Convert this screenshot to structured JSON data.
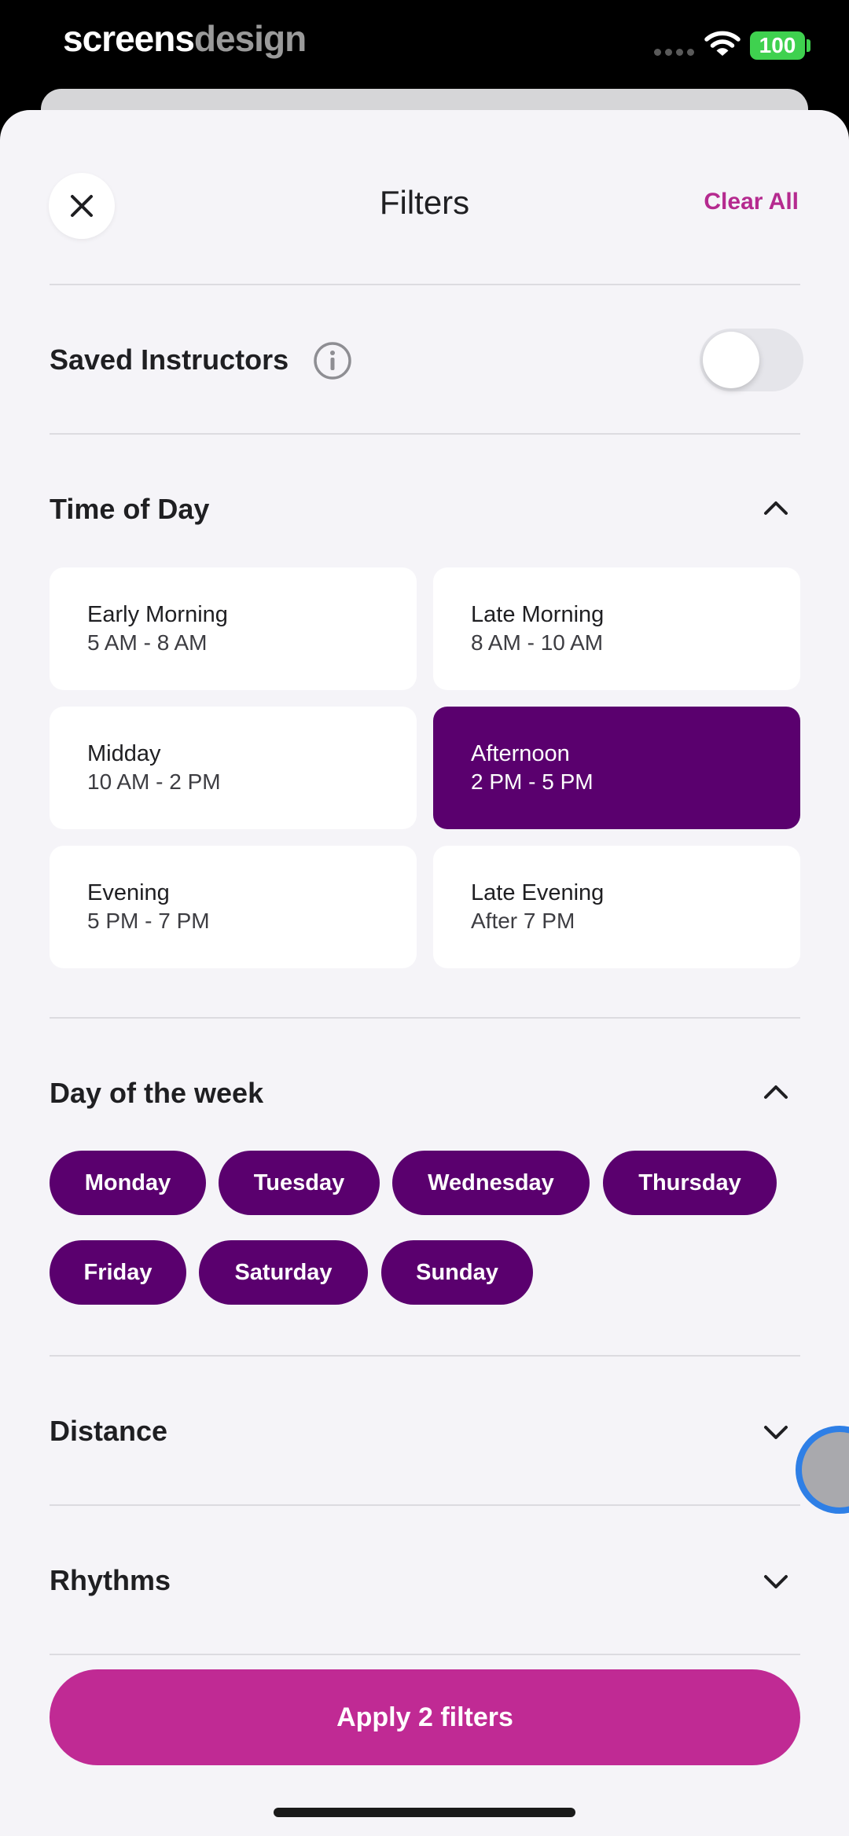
{
  "status_bar": {
    "brand_primary": "screens",
    "brand_secondary": "design",
    "battery": "100",
    "battery_color": "#3fd14f"
  },
  "header": {
    "title": "Filters",
    "clear_all_label": "Clear All",
    "close_icon": "close-icon"
  },
  "saved_instructors": {
    "label": "Saved Instructors",
    "info_icon": "info-icon",
    "toggle_on": false
  },
  "time_of_day": {
    "title": "Time of Day",
    "expanded": true,
    "options": [
      {
        "name": "Early Morning",
        "range": "5 AM - 8 AM",
        "selected": false
      },
      {
        "name": "Late Morning",
        "range": "8 AM - 10 AM",
        "selected": false
      },
      {
        "name": "Midday",
        "range": "10 AM - 2 PM",
        "selected": false
      },
      {
        "name": "Afternoon",
        "range": "2 PM - 5 PM",
        "selected": true
      },
      {
        "name": "Evening",
        "range": "5 PM - 7 PM",
        "selected": false
      },
      {
        "name": "Late Evening",
        "range": "After 7 PM",
        "selected": false
      }
    ]
  },
  "day_of_week": {
    "title": "Day of the week",
    "expanded": true,
    "days": [
      "Monday",
      "Tuesday",
      "Wednesday",
      "Thursday",
      "Friday",
      "Saturday",
      "Sunday"
    ]
  },
  "distance": {
    "title": "Distance",
    "expanded": false
  },
  "rhythms": {
    "title": "Rhythms",
    "expanded": false
  },
  "apply_button": {
    "label": "Apply 2 filters"
  },
  "colors": {
    "accent": "#c02a94",
    "selected": "#5a006e",
    "clear_all": "#b52a8f",
    "sheet_bg": "#f5f4f8"
  }
}
